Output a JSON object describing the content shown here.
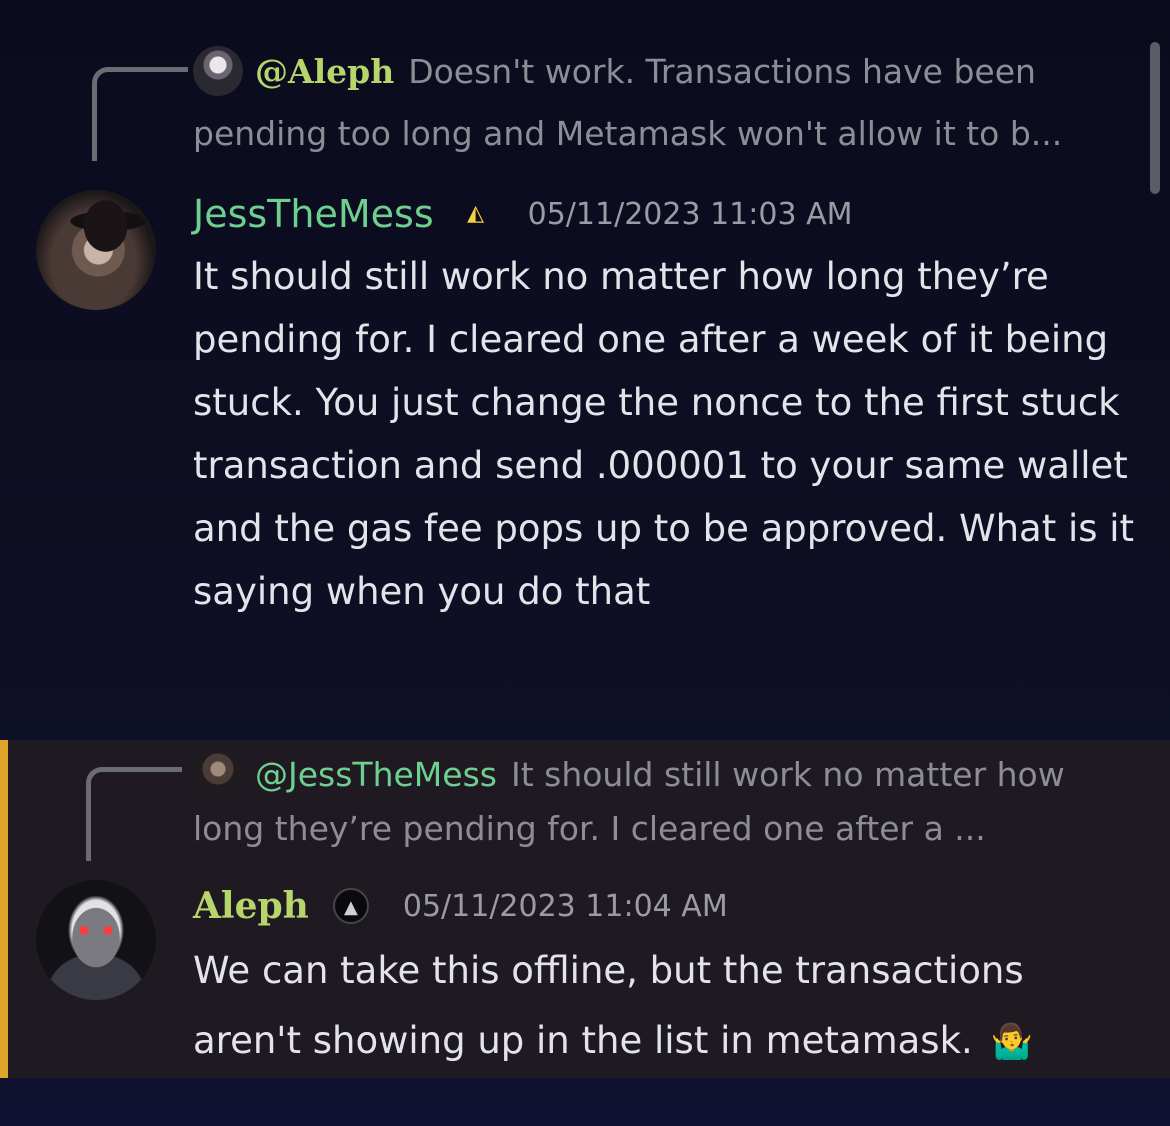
{
  "messages": [
    {
      "reply": {
        "mention": "@Aleph",
        "text": "Doesn't work. Transactions have been pending too long and Metamask won't allow it to b..."
      },
      "author": "JessTheMess",
      "timestamp": "05/11/2023 11:03 AM",
      "badge_icon": "yellow-triangle-badge-icon",
      "text": "It should still work no matter how long they’re pending for. I cleared one after a week of it being stuck. You just change the nonce to the first stuck transaction and send .000001 to your same wallet and the gas fee pops up to be approved. What is it saying when you do that"
    },
    {
      "reply": {
        "mention": "@JessTheMess",
        "text": "It should still work no matter how long they’re pending for. I cleared one after a ..."
      },
      "author": "Aleph",
      "timestamp": "05/11/2023 11:04 AM",
      "badge_icon": "dark-triangle-badge-icon",
      "text": "We can take this offline, but the transactions aren't showing up in the list in metamask.",
      "emoji": "🤷‍♂️"
    }
  ],
  "colors": {
    "background": "#0e0f24",
    "highlight_bar": "#e0a42c",
    "jess_name": "#6fcf8e",
    "aleph_name": "#b6d66c"
  }
}
